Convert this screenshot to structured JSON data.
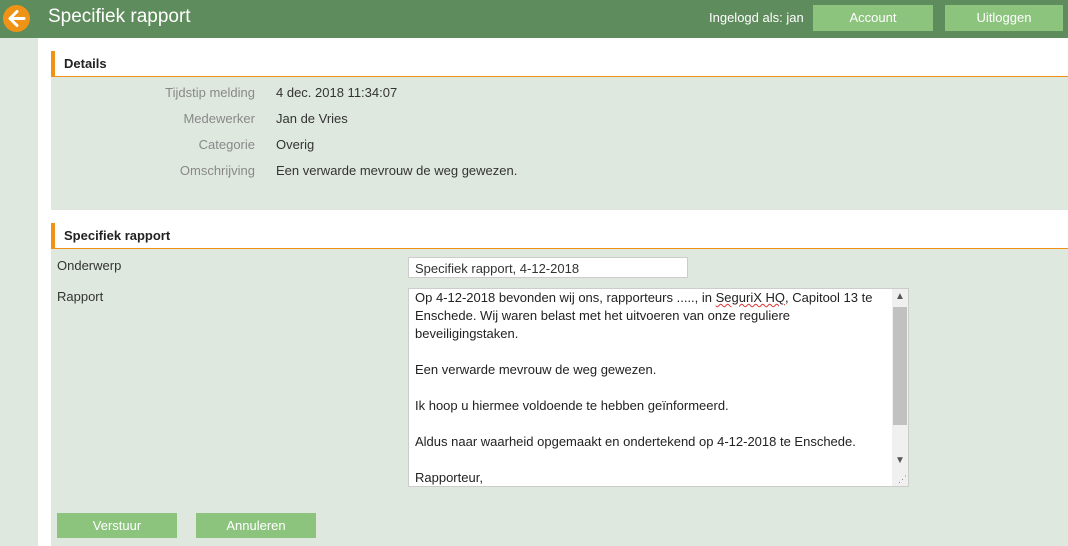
{
  "header": {
    "title": "Specifiek rapport",
    "login_label": "Ingelogd als: jan",
    "account_label": "Account",
    "logout_label": "Uitloggen"
  },
  "details": {
    "heading": "Details",
    "fields": [
      {
        "label": "Tijdstip melding",
        "value": "4 dec. 2018 11:34:07"
      },
      {
        "label": "Medewerker",
        "value": "Jan de Vries"
      },
      {
        "label": "Categorie",
        "value": "Overig"
      },
      {
        "label": "Omschrijving",
        "value": "Een verwarde mevrouw de weg gewezen."
      }
    ]
  },
  "report": {
    "heading": "Specifiek rapport",
    "subject_label": "Onderwerp",
    "subject_value": "Specifiek rapport, 4-12-2018",
    "body_label": "Rapport",
    "body_lines": {
      "line1_pre": "Op 4-12-2018 bevonden wij ons, rapporteurs ....., in ",
      "line1_spell": "SeguriX HQ",
      "line1_post": ", Capitool 13 te",
      "rest": "Enschede. Wij waren belast met het uitvoeren van onze reguliere\nbeveiligingstaken.\n\nEen verwarde mevrouw de weg gewezen.\n\nIk hoop u hiermee voldoende te hebben geïnformeerd.\n\nAldus naar waarheid opgemaakt en ondertekend op 4-12-2018 te Enschede.\n\nRapporteur,"
    }
  },
  "actions": {
    "submit_label": "Verstuur",
    "cancel_label": "Annuleren"
  },
  "colors": {
    "header_bg": "#5f8c5c",
    "button_bg": "#8cc47e",
    "accent": "#ef9316",
    "panel_bg": "#dfe8df"
  },
  "icons": {
    "back": "arrow-left-icon"
  }
}
